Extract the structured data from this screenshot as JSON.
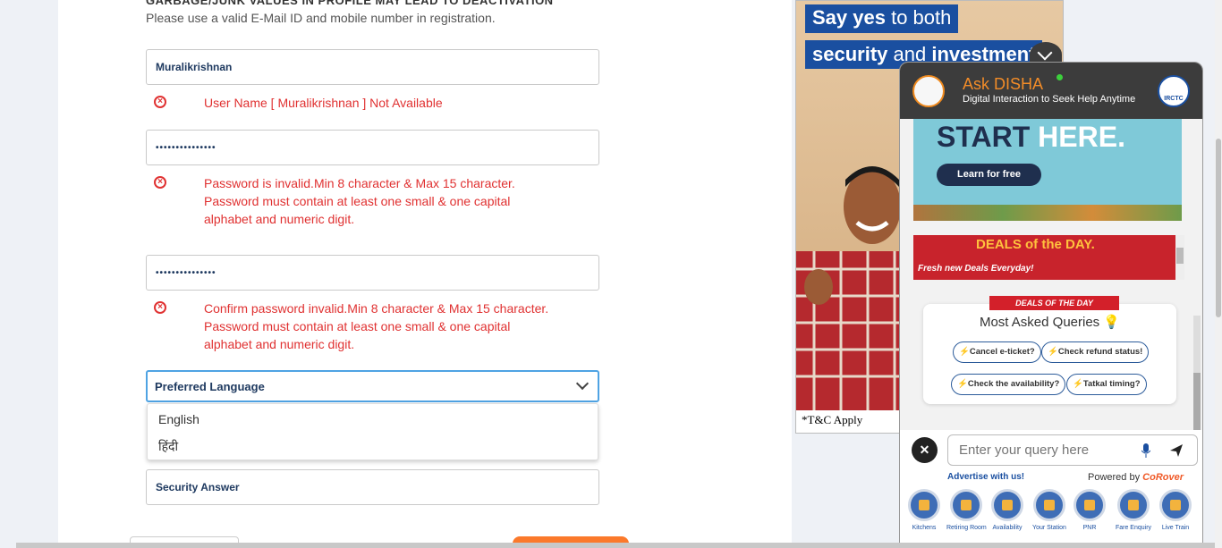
{
  "form": {
    "warning_heading": "GARBAGE/JUNK VALUES IN PROFILE MAY LEAD TO DEACTIVATION",
    "note": "Please use a valid E-Mail ID and mobile number in registration.",
    "username_value": "Muralikrishnan",
    "username_error": "User Name [ Muralikrishnan ] Not Available",
    "password_value": "•••••••••••••••",
    "password_error_1": "Password is invalid.Min 8 character & Max 15 character.",
    "password_error_2": "Password must contain at least one small & one capital",
    "password_error_3": "alphabet and numeric digit.",
    "confirm_value": "•••••••••••••••",
    "confirm_error_1": "Confirm password invalid.Min 8 character & Max 15 character.",
    "confirm_error_2": "Password must contain at least one small & one capital",
    "confirm_error_3": "alphabet and numeric digit.",
    "language_selected": "Preferred Language",
    "language_options": [
      "English",
      "हिंदी"
    ],
    "security_answer_placeholder": "Security Answer",
    "error_icon": "error-circle-icon"
  },
  "ad": {
    "line1_bold": "Say yes",
    "line1_thin": " to both",
    "line2_bold": "security",
    "line2_thin": " and ",
    "line2_bold2": "investment",
    "tc": "*T&C Apply"
  },
  "chatbot": {
    "title": "Ask DISHA",
    "subtitle": "Digital Interaction to Seek Help Anytime",
    "irctc_label": "IRCTC",
    "banner_start": "START",
    "banner_here": "HERE.",
    "learn_button": "Learn for free",
    "deals_title": "DEALS of the DAY.",
    "deals_sub": "Fresh new Deals Everyday!",
    "deals_tag": "DEALS OF THE DAY",
    "most_asked": "Most Asked Queries",
    "chips": [
      "Cancel e-ticket?",
      "Check refund status!",
      "Check the availability?",
      "Tatkal timing?"
    ],
    "query_placeholder": "Enter your query here",
    "advertise": "Advertise with us!",
    "powered_by": "Powered by ",
    "powered_brand": "CoRover",
    "quick_links": [
      "Kitchens",
      "Retiring Room",
      "Availability",
      "Your Station",
      "PNR",
      "Fare Enquiry",
      "Live Train"
    ]
  }
}
